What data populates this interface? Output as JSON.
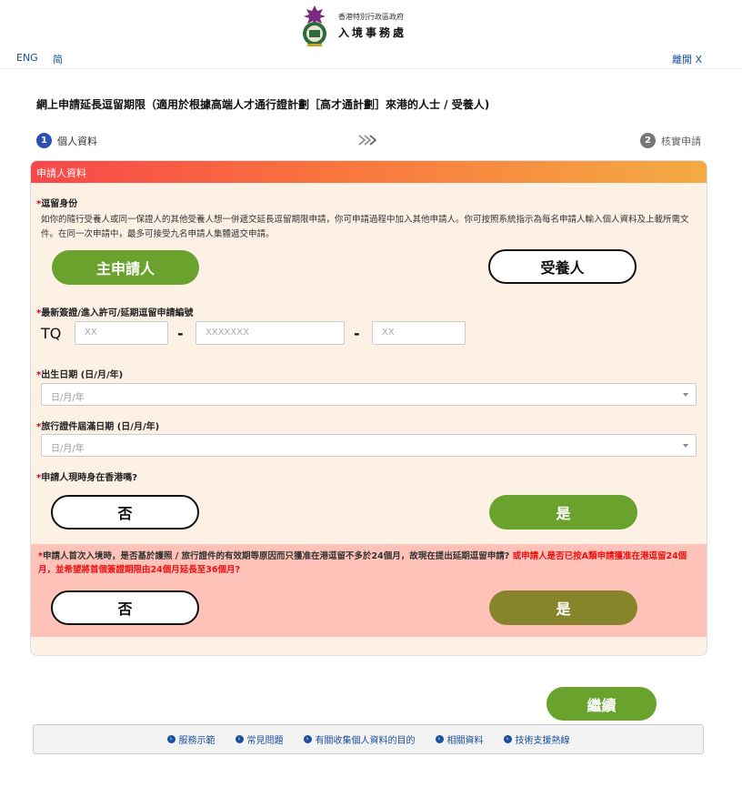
{
  "header": {
    "dept_name_line1": "香港特別行政區政府",
    "dept_name_line2": "入境事務處",
    "lang_english": "ENG",
    "lang_simplified": "简",
    "leave_label": "離開 X"
  },
  "page": {
    "title": "網上申請延長逗留期限（適用於根據高端人才通行證計劃［高才通計劃］來港的人士 / 受養人)"
  },
  "steps": [
    {
      "number": "1",
      "label": "個人資料",
      "active": true
    },
    {
      "number": "2",
      "label": "核實申請",
      "active": false
    }
  ],
  "form": {
    "section_title": "申請人資料",
    "stay_identity": {
      "label": "逗留身份",
      "description": "如你的隨行受養人或同一保證人的其他受養人想一併遞交延長逗留期限申請，你可申請過程中加入其他申請人。你可按照系統指示為每名申請人輸入個人資料及上載所需文件。在同一次申請中，最多可接受九名申請人集體遞交申請。",
      "option_main": "主申請人",
      "option_dependant": "受養人"
    },
    "visa_ref": {
      "label": "最新簽證/進入許可/延期逗留申請編號",
      "prefix": "TQ",
      "part1_placeholder": "XX",
      "part2_placeholder": "XXXXXXX",
      "part3_placeholder": "XX",
      "separator": "-"
    },
    "dob": {
      "label": "出生日期 (日/月/年)",
      "placeholder": "日/月/年"
    },
    "doc_expiry": {
      "label": "旅行證件屆滿日期 (日/月/年)",
      "placeholder": "日/月/年"
    },
    "in_hk": {
      "label": "申請人現時身在香港嗎?",
      "option_no": "否",
      "option_yes": "是"
    },
    "first_entry": {
      "question": "申請人首次入境時，是否基於護照 / 旅行證件的有效期等原因而只獲准在港逗留不多於24個月，故現在提出延期逗留申請?",
      "question_red": "或申請人是否已按A類申請獲准在港逗留24個月，並希望將首個簽證期限由24個月延長至36個月?",
      "option_no": "否",
      "option_yes": "是"
    },
    "required_mark": "*"
  },
  "actions": {
    "continue_label": "繼續"
  },
  "footer": {
    "links": [
      "服務示範",
      "常見問題",
      "有關收集個人資料的目的",
      "相關資料",
      "技術支援熱線"
    ]
  },
  "colors": {
    "green": "#6aa22e",
    "olive": "#87852c",
    "link_blue": "#1a4fa0",
    "alert_bg": "#fec2b9",
    "card_bg": "#fdf1e6"
  }
}
